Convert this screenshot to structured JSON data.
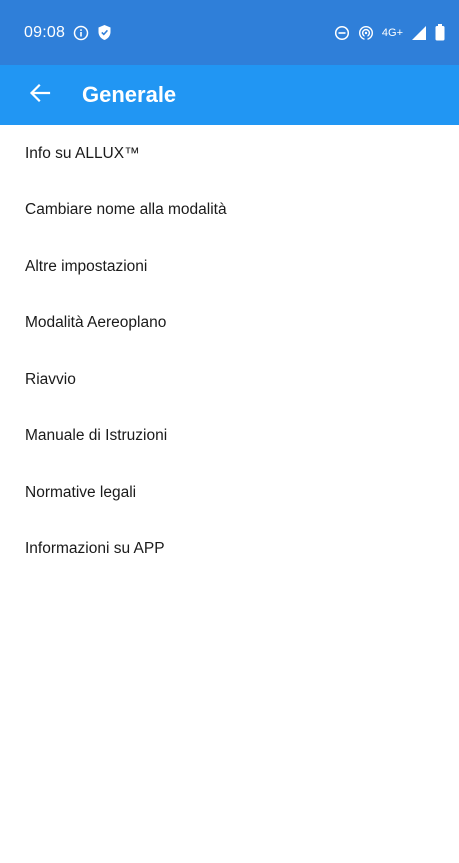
{
  "status_bar": {
    "time": "09:08",
    "network": "4G+"
  },
  "header": {
    "title": "Generale"
  },
  "menu": [
    {
      "label": "Info su ALLUX™"
    },
    {
      "label": "Cambiare nome alla modalità"
    },
    {
      "label": "Altre impostazioni"
    },
    {
      "label": "Modalità Aereoplano"
    },
    {
      "label": "Riavvio"
    },
    {
      "label": "Manuale di Istruzioni"
    },
    {
      "label": "Normative legali"
    },
    {
      "label": "Informazioni su APP"
    }
  ],
  "colors": {
    "status_bar": "#2f7fd9",
    "app_bar": "#2196f3",
    "text": "#1a1a1a"
  },
  "icons": [
    "info-icon",
    "shield-icon",
    "dnd-icon",
    "hotspot-icon",
    "signal-icon",
    "battery-icon",
    "back-arrow-icon"
  ]
}
